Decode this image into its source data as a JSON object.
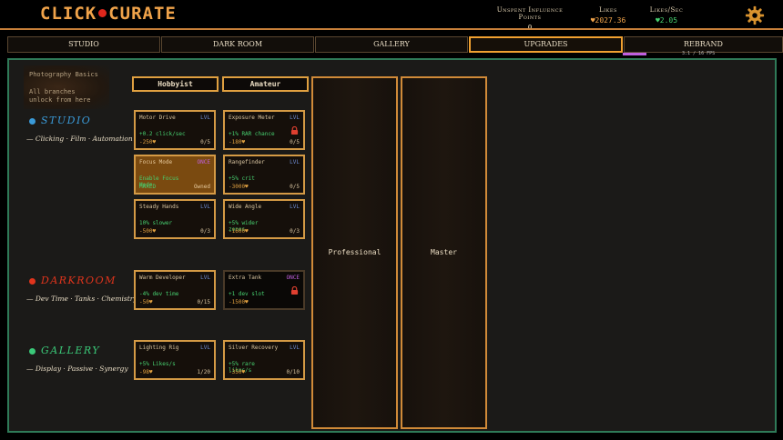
{
  "header": {
    "logo_left": "CLICK",
    "logo_right": "CURATE",
    "stats": [
      {
        "label": "Unspent Influence Points",
        "value": "0",
        "color": "#e6d6b6"
      },
      {
        "label": "Likes",
        "value": "♥2027.36",
        "color": "#f0a34a"
      },
      {
        "label": "Likes/Sec",
        "value": "♥2.05",
        "color": "#47d070"
      }
    ],
    "settings_icon": "gear-icon"
  },
  "tabs": [
    {
      "label": "Studio",
      "active": false
    },
    {
      "label": "Dark Room",
      "active": false
    },
    {
      "label": "Gallery",
      "active": false
    },
    {
      "label": "Upgrades",
      "active": true
    },
    {
      "label": "Rebrand",
      "active": false
    }
  ],
  "fps": "3.1 / 16 FPS",
  "progress_fraction": 0.26,
  "intro": {
    "title": "Photography Basics",
    "line1": "All branches",
    "line2": "unlock from here"
  },
  "tiers": [
    "Hobbyist",
    "Amateur",
    "Professional",
    "Master"
  ],
  "sections": [
    {
      "name": "STUDIO",
      "color": "#3a9ad8",
      "subtitle": "— Clicking · Film · Automation"
    },
    {
      "name": "DARKROOM",
      "color": "#e0341c",
      "subtitle": "— Dev Time · Tanks · Chemistry"
    },
    {
      "name": "GALLERY",
      "color": "#3ac878",
      "subtitle": "— Display · Passive · Synergy"
    }
  ],
  "cards": [
    {
      "title": "Motor Drive",
      "kind": "LVL",
      "effect": "+0.2 click/sec",
      "effect2": "",
      "cost": "-250♥",
      "level": "0/5",
      "locked": false,
      "maxed": false
    },
    {
      "title": "Exposure Meter",
      "kind": "LVL",
      "effect": "+1% RAR chance",
      "effect2": "",
      "cost": "-180♥",
      "level": "0/5",
      "locked": true,
      "maxed": false
    },
    {
      "title": "Focus Mode",
      "kind": "ONCE",
      "effect": "Enable Focus",
      "effect2": "Mode",
      "cost": "MAXED",
      "level": "Owned",
      "locked": false,
      "maxed": true
    },
    {
      "title": "Rangefinder",
      "kind": "LVL",
      "effect": "+5% crit",
      "effect2": "",
      "cost": "-3000♥",
      "level": "0/5",
      "locked": false,
      "maxed": false
    },
    {
      "title": "Steady Hands",
      "kind": "LVL",
      "effect": "10% slower",
      "effect2": "",
      "cost": "-500♥",
      "level": "0/3",
      "locked": false,
      "maxed": false
    },
    {
      "title": "Wide Angle",
      "kind": "LVL",
      "effect": "+5% wider",
      "effect2": "zones",
      "cost": "-1600♥",
      "level": "0/3",
      "locked": false,
      "maxed": false
    },
    {
      "title": "Warm Developer",
      "kind": "LVL",
      "effect": "-4% dev time",
      "effect2": "",
      "cost": "-50♥",
      "level": "0/15",
      "locked": false,
      "maxed": false
    },
    {
      "title": "Extra Tank",
      "kind": "ONCE",
      "effect": "+1 dev slot",
      "effect2": "",
      "cost": "-1500♥",
      "level": "",
      "locked": true,
      "maxed": false
    },
    {
      "title": "Lighting Rig",
      "kind": "LVL",
      "effect": "+5% Likes/s",
      "effect2": "",
      "cost": "-98♥",
      "level": "1/20",
      "locked": false,
      "maxed": false
    },
    {
      "title": "Silver Recovery",
      "kind": "LVL",
      "effect": "+5% rare",
      "effect2": "likes/s",
      "cost": "-350♥",
      "level": "0/10",
      "locked": false,
      "maxed": false
    }
  ]
}
